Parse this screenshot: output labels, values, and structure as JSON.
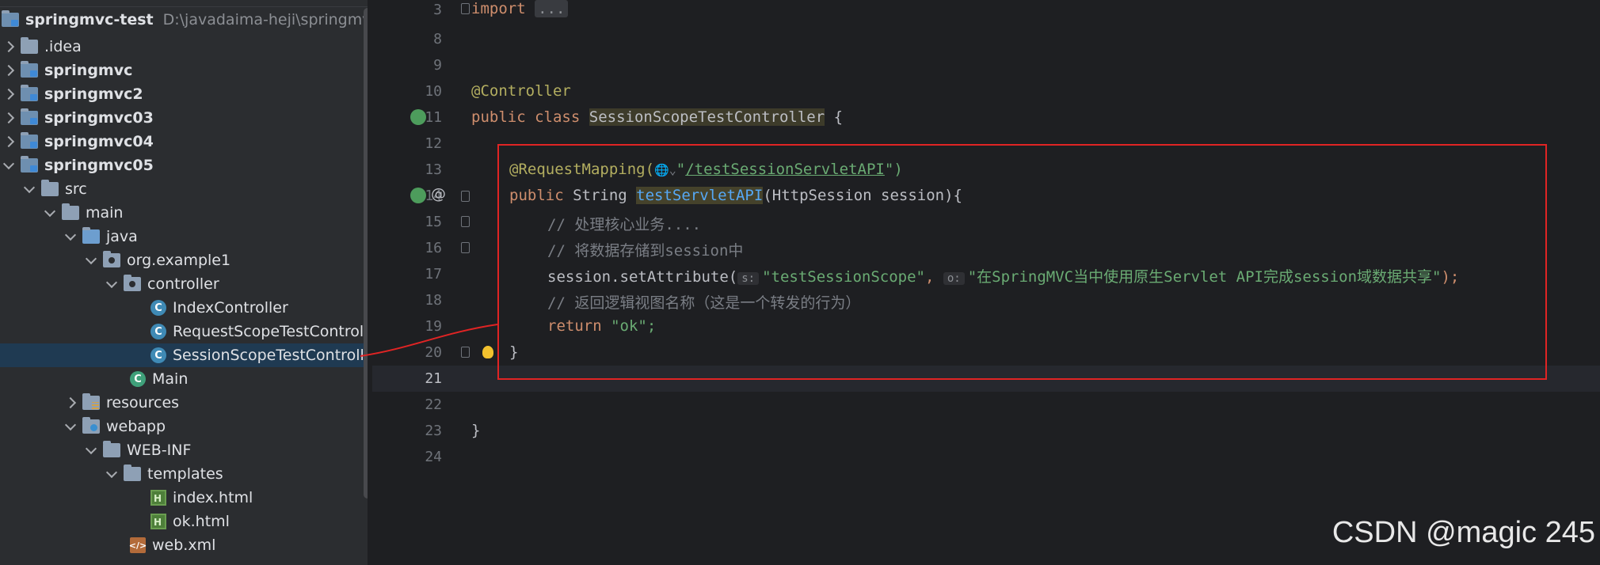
{
  "tree": {
    "root": {
      "name": "springmvc-test",
      "path": "D:\\javadaima-heji\\springmvc-test"
    },
    "items": [
      {
        "label": ".idea",
        "bold": false
      },
      {
        "label": "springmvc",
        "bold": true
      },
      {
        "label": "springmvc2",
        "bold": true
      },
      {
        "label": "springmvc03",
        "bold": true
      },
      {
        "label": "springmvc04",
        "bold": true
      },
      {
        "label": "springmvc05",
        "bold": true
      },
      {
        "label": "src"
      },
      {
        "label": "main"
      },
      {
        "label": "java"
      },
      {
        "label": "org.example1"
      },
      {
        "label": "controller"
      },
      {
        "label": "IndexController"
      },
      {
        "label": "RequestScopeTestController"
      },
      {
        "label": "SessionScopeTestController"
      },
      {
        "label": "Main"
      },
      {
        "label": "resources"
      },
      {
        "label": "webapp"
      },
      {
        "label": "WEB-INF"
      },
      {
        "label": "templates"
      },
      {
        "label": "index.html"
      },
      {
        "label": "ok.html"
      },
      {
        "label": "web.xml"
      }
    ]
  },
  "editor": {
    "line_numbers": [
      "3",
      "8",
      "9",
      "10",
      "11",
      "12",
      "13",
      "14",
      "15",
      "16",
      "17",
      "18",
      "19",
      "20",
      "21",
      "22",
      "23",
      "24"
    ],
    "code": {
      "import": "import",
      "import_fold": "...",
      "controller_ann": "@Controller",
      "public": "public",
      "class_kw": "class",
      "class_name": "SessionScopeTestController",
      "brace_open": " {",
      "mapping_ann": "@RequestMapping(",
      "mapping_icon": "🌐⌄",
      "mapping_q1": "\"",
      "mapping_url": "/testSessionServletAPI",
      "mapping_end": "\")",
      "string_type": " String ",
      "method_name": "testServletAPI",
      "method_params": "(HttpSession session){",
      "comment1": "// 处理核心业务....",
      "comment2": "// 将数据存储到session中",
      "set_attr": "session.setAttribute(",
      "hint_s": "s:",
      "arg1": "\"testSessionScope\"",
      "comma": ", ",
      "hint_o": "o:",
      "arg2": "\"在SpringMVC当中使用原生Servlet API完成session域数据共享\"",
      "set_attr_end": ");",
      "comment3": "// 返回逻辑视图名称（这是一个转发的行为）",
      "return_kw": "return",
      "return_val": " \"ok\";",
      "inner_close": "}",
      "outer_close": "}"
    }
  },
  "watermark": "CSDN @magic 245",
  "colors": {
    "annotation_box": "#e02424",
    "selection": "#1f3a52"
  }
}
